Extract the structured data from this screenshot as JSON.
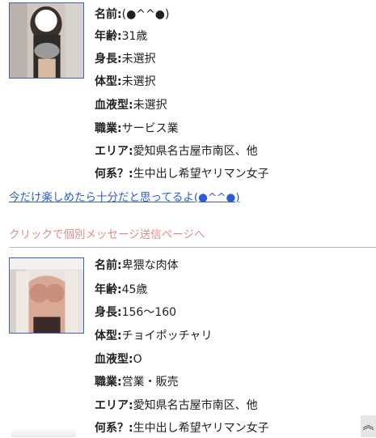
{
  "profile1": {
    "name": {
      "label": "名前:",
      "value": "(●^^●)"
    },
    "age": {
      "label": "年齢:",
      "value": "31歳"
    },
    "height": {
      "label": "身長:",
      "value": "未選択"
    },
    "body": {
      "label": "体型:",
      "value": "未選択"
    },
    "blood": {
      "label": "血液型:",
      "value": "未選択"
    },
    "job": {
      "label": "職業:",
      "value": "サービス業"
    },
    "area": {
      "label": "エリア:",
      "value": "愛知県名古屋市南区、他"
    },
    "type": {
      "label": "何系？:",
      "value": "生中出し希望ヤリマン女子"
    },
    "message_link": "今だけ楽しめたら十分だと思ってるよ(●^^●)",
    "send_link": "クリックで個別メッセージ送信ページへ"
  },
  "profile2": {
    "name": {
      "label": "名前:",
      "value": "卑猥な肉体"
    },
    "age": {
      "label": "年齢:",
      "value": "45歳"
    },
    "height": {
      "label": "身長:",
      "value": "156〜160"
    },
    "body": {
      "label": "体型:",
      "value": "チョイポッチャリ"
    },
    "blood": {
      "label": "血液型:",
      "value": "O"
    },
    "job": {
      "label": "職業:",
      "value": "営業・販売"
    },
    "area": {
      "label": "エリア:",
      "value": "愛知県名古屋市南区、他"
    },
    "type": {
      "label": "何系？:",
      "value": "生中出し希望ヤリマン女子"
    }
  },
  "scroll_top_icon": "double-chevron-up-icon",
  "colors": {
    "link_blue": "#2d5bd1",
    "link_pink": "#e58a8a",
    "photo_border": "#3a63c7"
  }
}
